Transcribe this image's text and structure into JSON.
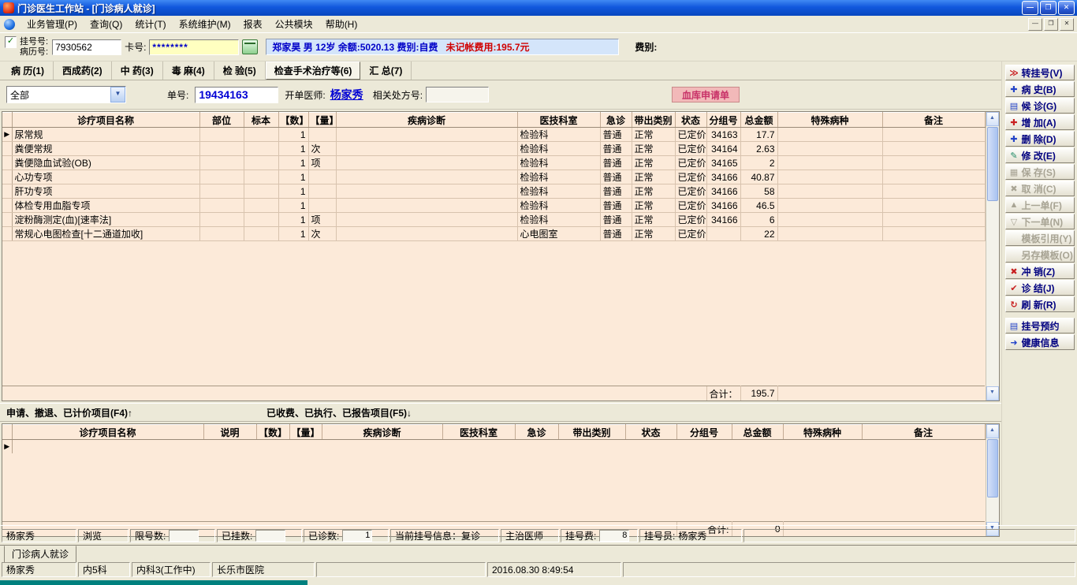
{
  "colors": {
    "menu_bg": "#ece9d8",
    "table_bg": "#fcead9",
    "grid_line": "#d8c3ae",
    "card_field_bg": "#ffffc0",
    "patient_bar_bg": "#d4e5fa",
    "accent_blue": "#0000c8",
    "alert_red": "#d00000",
    "sidebar_text": "#000080"
  },
  "icons": {
    "minimize": "—",
    "restore": "❐",
    "close": "✕",
    "check": "✓",
    "dropdown_arrow": "▼",
    "scroll_up": "▲",
    "scroll_down": "▼",
    "row_marker": "▶"
  },
  "window": {
    "title": "门诊医生工作站 - [门诊病人就诊]",
    "menu": [
      "业务管理(P)",
      "查询(Q)",
      "统计(T)",
      "系统维护(M)",
      "报表",
      "公共模块",
      "帮助(H)"
    ]
  },
  "form": {
    "reg_label": "挂号号:",
    "record_label": "病历号:",
    "record_value": "7930562",
    "card_label": "卡号:",
    "card_value": "********",
    "patient_main": "郑家昊  男  12岁  余额:5020.13  费别:自费",
    "patient_unbilled": "未记帐费用:195.7元",
    "fee_type_label": "费别:"
  },
  "tabs": [
    {
      "label": "病 历(1)",
      "selected": false
    },
    {
      "label": "西成药(2)",
      "selected": false
    },
    {
      "label": "中 药(3)",
      "selected": false
    },
    {
      "label": "毒 麻(4)",
      "selected": false
    },
    {
      "label": "检 验(5)",
      "selected": false
    },
    {
      "label": "检查手术治疗等(6)",
      "selected": true
    },
    {
      "label": "汇 总(7)",
      "selected": false
    }
  ],
  "toolbar": {
    "filter_value": "全部",
    "order_label": "单号:",
    "order_value": "19434163",
    "doctor_label": "开单医师:",
    "doctor_value": "杨家秀",
    "rx_label": "相关处方号:",
    "rx_value": "",
    "blood_button": "血库申请单"
  },
  "table1": {
    "columns": [
      "诊疗项目名称",
      "部位",
      "标本",
      "【数】",
      "【量】",
      "疾病诊断",
      "医技科室",
      "急诊",
      "带出类别",
      "状态",
      "分组号",
      "总金额",
      "特殊病种",
      "备注"
    ],
    "current_row": 0,
    "rows": [
      [
        "尿常规",
        "",
        "",
        "1",
        "",
        "",
        "检验科",
        "普通",
        "正常",
        "已定价",
        "34163",
        "17.7",
        "",
        ""
      ],
      [
        "粪便常规",
        "",
        "",
        "1",
        "次",
        "",
        "检验科",
        "普通",
        "正常",
        "已定价",
        "34164",
        "2.63",
        "",
        ""
      ],
      [
        "粪便隐血试验(OB)",
        "",
        "",
        "1",
        "项",
        "",
        "检验科",
        "普通",
        "正常",
        "已定价",
        "34165",
        "2",
        "",
        ""
      ],
      [
        "心功专项",
        "",
        "",
        "1",
        "",
        "",
        "检验科",
        "普通",
        "正常",
        "已定价",
        "34166",
        "40.87",
        "",
        ""
      ],
      [
        "肝功专项",
        "",
        "",
        "1",
        "",
        "",
        "检验科",
        "普通",
        "正常",
        "已定价",
        "34166",
        "58",
        "",
        ""
      ],
      [
        "体检专用血脂专项",
        "",
        "",
        "1",
        "",
        "",
        "检验科",
        "普通",
        "正常",
        "已定价",
        "34166",
        "46.5",
        "",
        ""
      ],
      [
        "淀粉酶测定(血)[速率法]",
        "",
        "",
        "1",
        "项",
        "",
        "检验科",
        "普通",
        "正常",
        "已定价",
        "34166",
        "6",
        "",
        ""
      ],
      [
        "常规心电图检查[十二通道加收]",
        "",
        "",
        "1",
        "次",
        "",
        "心电图室",
        "普通",
        "正常",
        "已定价",
        "",
        "22",
        "",
        ""
      ]
    ],
    "total_label": "合计：",
    "total_value": "195.7"
  },
  "split": {
    "upper_label": "申请、撤退、已计价项目(F4)↑",
    "lower_label": "已收费、已执行、已报告项目(F5)↓"
  },
  "table2": {
    "columns": [
      "诊疗项目名称",
      "说明",
      "【数】",
      "【量】",
      "疾病诊断",
      "医技科室",
      "急诊",
      "带出类别",
      "状态",
      "分组号",
      "总金额",
      "特殊病种",
      "备注"
    ],
    "rows": [],
    "total_label": "合计:",
    "total_value": "0"
  },
  "sidebar": {
    "buttons": [
      {
        "label": "转挂号(V)",
        "icon": "transfer-reg-icon",
        "glyph": "≫",
        "color": "#c82020",
        "enabled": true
      },
      {
        "label": "病 史(B)",
        "icon": "history-icon",
        "glyph": "✚",
        "color": "#2343c8",
        "enabled": true
      },
      {
        "label": "候 诊(G)",
        "icon": "waiting-list-icon",
        "glyph": "▤",
        "color": "#2343c8",
        "enabled": true
      },
      {
        "label": "增 加(A)",
        "icon": "add-icon",
        "glyph": "✚",
        "color": "#c82020",
        "enabled": true
      },
      {
        "label": "删 除(D)",
        "icon": "delete-icon",
        "glyph": "✚",
        "color": "#2343c8",
        "enabled": true
      },
      {
        "label": "修 改(E)",
        "icon": "edit-icon",
        "glyph": "✎",
        "color": "#1f8a66",
        "enabled": true
      },
      {
        "label": "保 存(S)",
        "icon": "save-icon",
        "glyph": "▦",
        "color": "#a8a494",
        "enabled": false
      },
      {
        "label": "取 消(C)",
        "icon": "cancel-icon",
        "glyph": "✖",
        "color": "#a8a494",
        "enabled": false
      },
      {
        "label": "上一单(F)",
        "icon": "prev-order-icon",
        "glyph": "▲",
        "color": "#a8a494",
        "enabled": false
      },
      {
        "label": "下一单(N)",
        "icon": "next-order-icon",
        "glyph": "▽",
        "color": "#a8a494",
        "enabled": false
      },
      {
        "label": "模板引用(Y)",
        "icon": "template-ref-icon",
        "glyph": "",
        "color": "#a8a494",
        "enabled": false
      },
      {
        "label": "另存模板(O)",
        "icon": "template-saveas-icon",
        "glyph": "",
        "color": "#a8a494",
        "enabled": false
      },
      {
        "label": "冲 销(Z)",
        "icon": "reverse-icon",
        "glyph": "✖",
        "color": "#c82020",
        "enabled": true
      },
      {
        "label": "诊 结(J)",
        "icon": "finish-icon",
        "glyph": "✔",
        "color": "#c82020",
        "enabled": true
      },
      {
        "label": "刷 新(R)",
        "icon": "refresh-icon",
        "glyph": "↻",
        "color": "#c82020",
        "enabled": true
      },
      {
        "label": "挂号预约",
        "icon": "reservation-icon",
        "glyph": "▤",
        "color": "#2343c8",
        "enabled": true
      },
      {
        "label": "健康信息",
        "icon": "health-info-icon",
        "glyph": "➜",
        "color": "#2343c8",
        "enabled": true
      }
    ]
  },
  "status_top": {
    "operator": "杨家秀",
    "mode": "浏览",
    "limit_label": "限号数:",
    "limit_value": "",
    "registered_label": "已挂数:",
    "registered_value": "",
    "seen_label": "已诊数:",
    "seen_value": "1",
    "current_reg_info": "当前挂号信息：复诊",
    "doctor_title": "主治医师",
    "reg_fee_label": "挂号费:",
    "reg_fee_value": "8",
    "registrar_label": "挂号员:",
    "registrar_value": "杨家秀"
  },
  "bottom_tab": {
    "label": "门诊病人就诊"
  },
  "status_bottom": {
    "operator": "杨家秀",
    "dept": "内5科",
    "room": "内科3(工作中)",
    "hospital": "长乐市医院",
    "datetime": "2016.08.30 8:49:54"
  }
}
